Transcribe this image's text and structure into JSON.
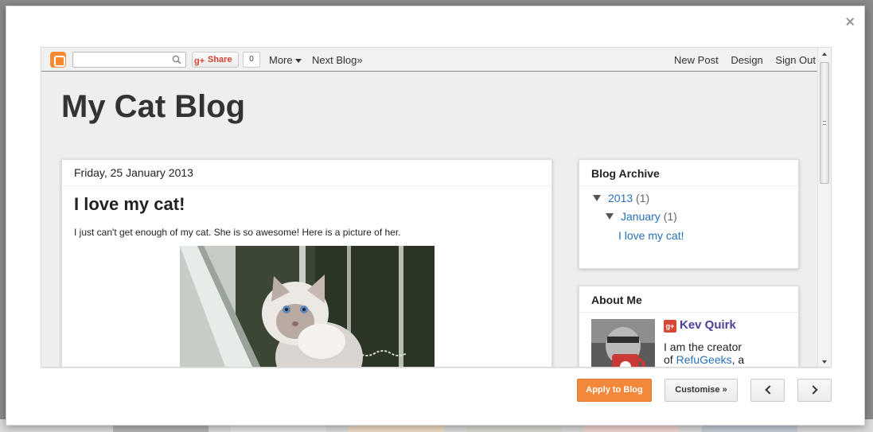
{
  "navbar": {
    "search_placeholder": "",
    "share_label": "Share",
    "share_count": "0",
    "more_label": "More",
    "next_blog_label": "Next Blog»",
    "right_links": [
      "New Post",
      "Design",
      "Sign Out"
    ]
  },
  "blog": {
    "title": "My Cat Blog",
    "post": {
      "date": "Friday, 25 January 2013",
      "title": "I love my cat!",
      "body": "I just can't get enough of my cat. She is so awesome! Here is a picture of her."
    }
  },
  "archive": {
    "title": "Blog Archive",
    "year": "2013",
    "year_count": "(1)",
    "month": "January",
    "month_count": "(1)",
    "post_link": "I love my cat!"
  },
  "about": {
    "title": "About Me",
    "name": "Kev Quirk",
    "text_line1": "I am the creator",
    "text_line2_prefix": "of ",
    "text_link": "RefuGeeks",
    "text_line2_suffix": ", a"
  },
  "footer": {
    "apply_label": "Apply to Blog",
    "customise_label": "Customise »"
  },
  "colors": {
    "accent": "#f3883b",
    "link": "#2870b8",
    "author": "#4c3f9c"
  }
}
